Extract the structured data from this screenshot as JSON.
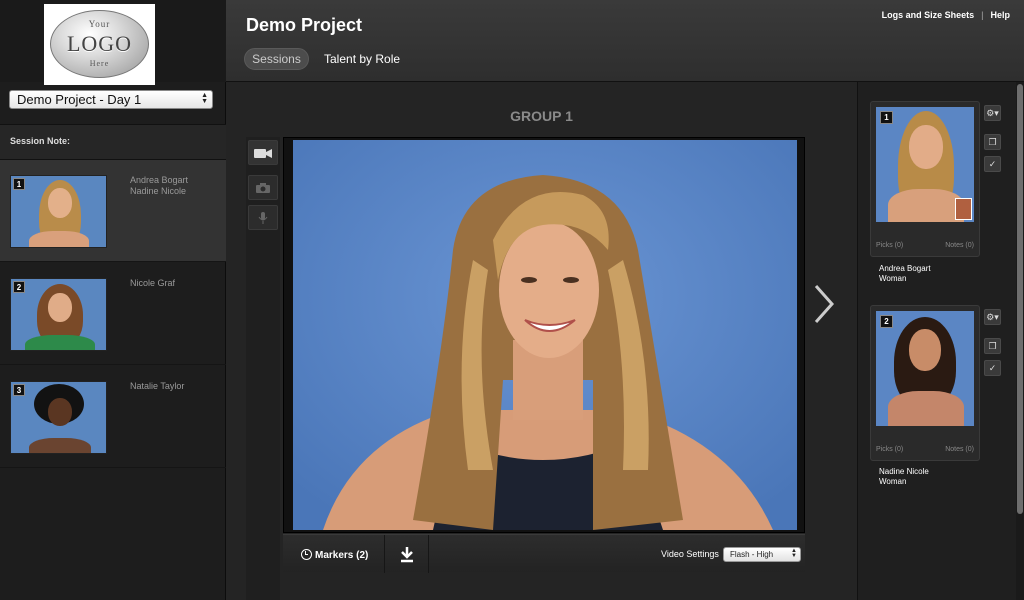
{
  "logo": {
    "top": "Your",
    "main": "LOGO",
    "bottom": "Here"
  },
  "left": {
    "day_select": "Demo Project - Day 1",
    "session_note_label": "Session Note:",
    "sessions": [
      {
        "num": "1",
        "names": [
          "Andrea Bogart",
          "Nadine Nicole"
        ]
      },
      {
        "num": "2",
        "names": [
          "Nicole Graf"
        ]
      },
      {
        "num": "3",
        "names": [
          "Natalie Taylor"
        ]
      }
    ]
  },
  "header": {
    "title": "Demo Project",
    "tabs": {
      "sessions": "Sessions",
      "talent": "Talent by Role"
    },
    "links": {
      "logs": "Logs and Size Sheets",
      "help": "Help"
    }
  },
  "main": {
    "group_title": "GROUP 1",
    "markers_label": "Markers (2)",
    "video_settings_label": "Video Settings",
    "video_quality": "Flash - High"
  },
  "talent": [
    {
      "num": "1",
      "picks": "Picks (0)",
      "notes": "Notes (0)",
      "name": "Andrea Bogart",
      "role": "Woman"
    },
    {
      "num": "2",
      "picks": "Picks (0)",
      "notes": "Notes (0)",
      "name": "Nadine Nicole",
      "role": "Woman"
    }
  ],
  "icons": [
    "video-camera-icon",
    "photo-camera-icon",
    "microphone-icon",
    "clock-icon",
    "download-icon",
    "next-arrow-icon",
    "gear-icon",
    "copy-icon",
    "check-icon"
  ],
  "colors": {
    "backdrop_blue": "#5b86c8",
    "panel_dark": "#1d1d1d",
    "header": "#343434"
  }
}
